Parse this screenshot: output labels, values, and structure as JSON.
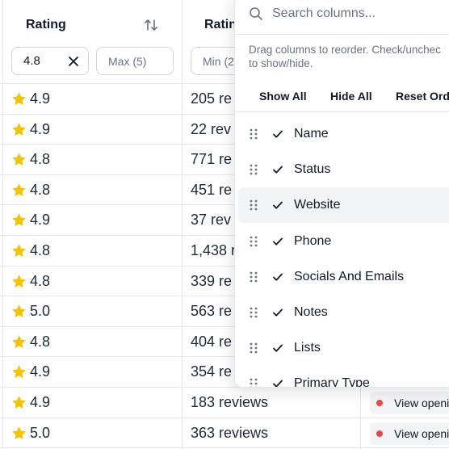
{
  "header": {
    "rating_title": "Rating",
    "rating_min_value": "4.8",
    "rating_max_placeholder": "Max (5)",
    "reviews_title": "Ratin",
    "reviews_min_placeholder": "Min (2"
  },
  "rows": [
    {
      "rating": "4.9",
      "reviews": "205 re"
    },
    {
      "rating": "4.9",
      "reviews": "22 rev"
    },
    {
      "rating": "4.8",
      "reviews": "771 re"
    },
    {
      "rating": "4.8",
      "reviews": "451 re"
    },
    {
      "rating": "4.9",
      "reviews": "37 rev"
    },
    {
      "rating": "4.8",
      "reviews": "1,438 r"
    },
    {
      "rating": "4.8",
      "reviews": "339 re"
    },
    {
      "rating": "5.0",
      "reviews": "563 re"
    },
    {
      "rating": "4.8",
      "reviews": "404 re"
    },
    {
      "rating": "4.9",
      "reviews": "354 re"
    },
    {
      "rating": "4.9",
      "reviews": "183 reviews",
      "hours": "View openi"
    },
    {
      "rating": "5.0",
      "reviews": "363 reviews",
      "hours": "View openi"
    }
  ],
  "popover": {
    "search_placeholder": "Search columns...",
    "hint_line1": "Drag columns to reorder. Check/unchec",
    "hint_line2": "to show/hide.",
    "show_all": "Show All",
    "hide_all": "Hide All",
    "reset_order": "Reset Orde",
    "columns": [
      {
        "label": "Name",
        "checked": true
      },
      {
        "label": "Status",
        "checked": true
      },
      {
        "label": "Website",
        "checked": true
      },
      {
        "label": "Phone",
        "checked": true
      },
      {
        "label": "Socials And Emails",
        "checked": true
      },
      {
        "label": "Notes",
        "checked": true
      },
      {
        "label": "Lists",
        "checked": true
      },
      {
        "label": "Primary Type",
        "checked": true
      }
    ]
  },
  "colors": {
    "star": "#f5c400",
    "status_dot": "#ef4444",
    "highlight_row": "#f3f4f6"
  }
}
